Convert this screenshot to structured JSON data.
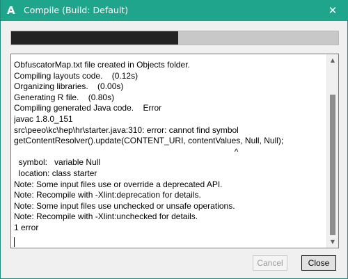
{
  "window": {
    "app_icon_glyph": "A",
    "title": "Compile (Build: Default)",
    "close_glyph": "✕"
  },
  "progress": {
    "fraction": 0.51
  },
  "log": {
    "text": "ObfuscatorMap.txt file created in Objects folder.\nCompiling layouts code.    (0.12s)\nOrganizing libraries.    (0.00s)\nGenerating R file.    (0.80s)\nCompiling generated Java code.    Error\njavac 1.8.0_151\nsrc\\peeo\\kc\\hep\\hr\\starter.java:310: error: cannot find symbol\ngetContentResolver().update(CONTENT_URI, contentValues, Null, Null);\n                                                                                               ^\n  symbol:   variable Null\n  location: class starter\nNote: Some input files use or override a deprecated API.\nNote: Recompile with -Xlint:deprecation for details.\nNote: Some input files use unchecked or unsafe operations.\nNote: Recompile with -Xlint:unchecked for details.\n1 error"
  },
  "scrollbar": {
    "up_glyph": "▲",
    "down_glyph": "▼"
  },
  "buttons": {
    "cancel": "Cancel",
    "close": "Close"
  },
  "colors": {
    "titlebar": "#1fa58b",
    "progress_fill": "#232323",
    "progress_track": "#c8c8c8"
  }
}
